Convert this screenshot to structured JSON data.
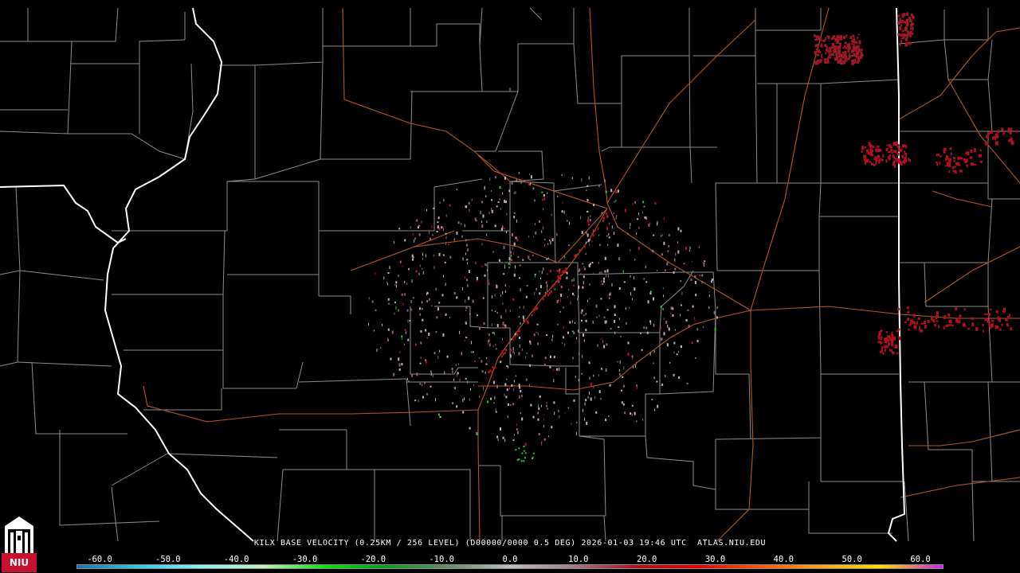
{
  "product_caption": "KILX BASE VELOCITY (0.25KM / 256 LEVEL) (D00000/0000 0.5 DEG) 2026-01-03 19:46 UTC  ATLAS.NIU.EDU",
  "logo_text": "NIU",
  "colorbar": {
    "ticks": [
      "-60.0",
      "-50.0",
      "-40.0",
      "-30.0",
      "-20.0",
      "-10.0",
      "0.0",
      "10.0",
      "20.0",
      "30.0",
      "40.0",
      "50.0",
      "60.0"
    ],
    "gradient_stops": [
      "#1f6fb0",
      "#38c8e8",
      "#8ff0f0",
      "#c8f0c0",
      "#10e010",
      "#0a9a20",
      "#6a8a6a",
      "#c0c0c0",
      "#a08090",
      "#b01020",
      "#e00000",
      "#ff5010",
      "#ffa020",
      "#ffe000",
      "#d020f0"
    ]
  },
  "colors": {
    "county_lines": "#8c8c8c",
    "state_lines": "#ffffff",
    "highways": "#b5562a",
    "outbound": "#c01020",
    "inbound": "#18d030",
    "noise": "#c8b0b0"
  }
}
